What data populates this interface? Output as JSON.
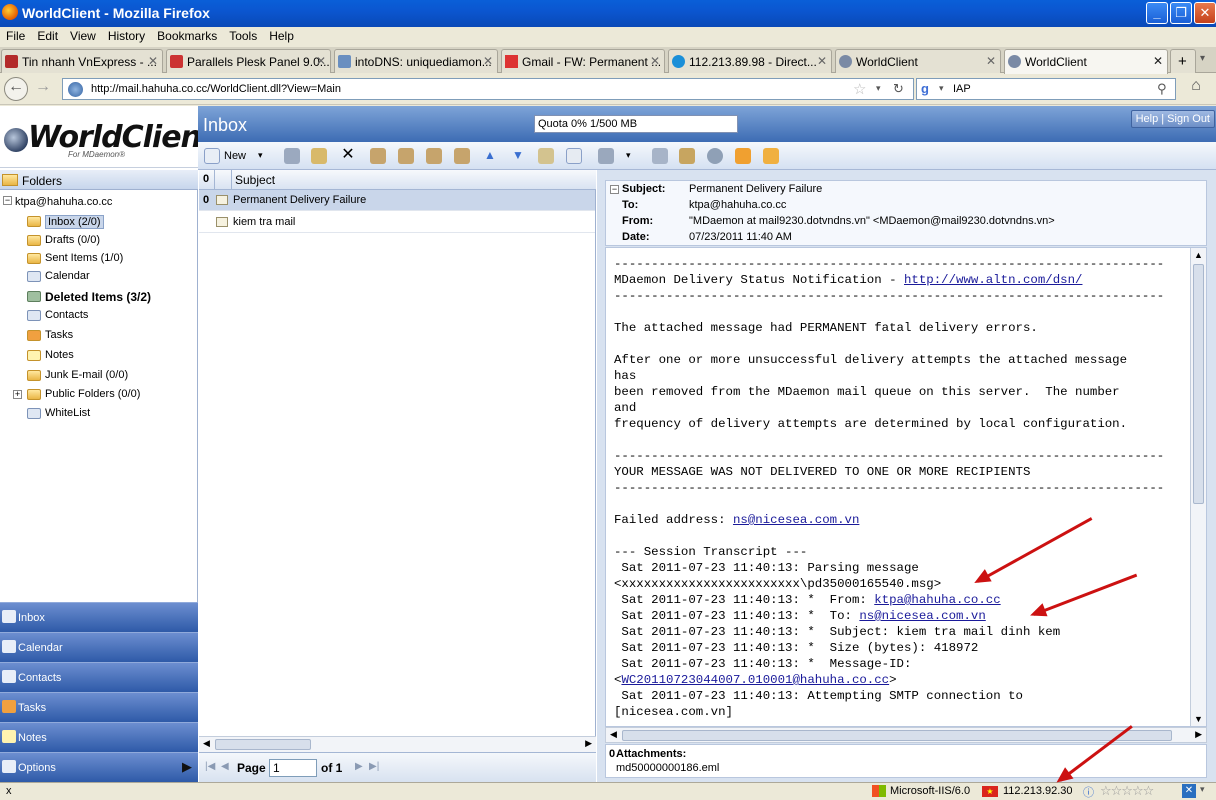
{
  "window": {
    "title": "WorldClient - Mozilla Firefox"
  },
  "menu": [
    "File",
    "Edit",
    "View",
    "History",
    "Bookmarks",
    "Tools",
    "Help"
  ],
  "tabs": [
    {
      "label": "Tin nhanh VnExpress - ..."
    },
    {
      "label": "Parallels Plesk Panel 9.0..."
    },
    {
      "label": "intoDNS: uniquediamon..."
    },
    {
      "label": "Gmail - FW: Permanent ..."
    },
    {
      "label": "112.213.89.98 - Direct..."
    },
    {
      "label": "WorldClient"
    },
    {
      "label": "WorldClient"
    }
  ],
  "nav": {
    "url": "http://mail.hahuha.co.cc/WorldClient.dll?View=Main",
    "search_value": "IAP"
  },
  "app": {
    "logo": "WorldClient",
    "logo_sub": "For MDaemon®",
    "header_title": "Inbox",
    "quota": "Quota 0% 1/500 MB",
    "help_signout": "Help | Sign Out",
    "toolbar_new": "New"
  },
  "folders": {
    "heading": "Folders",
    "account": "ktpa@hahuha.co.cc",
    "items": [
      {
        "label": "Inbox (2/0)"
      },
      {
        "label": "Drafts (0/0)"
      },
      {
        "label": "Sent Items (1/0)"
      },
      {
        "label": "Calendar"
      },
      {
        "label": "Deleted Items (3/2)"
      },
      {
        "label": "Contacts"
      },
      {
        "label": "Tasks"
      },
      {
        "label": "Notes"
      },
      {
        "label": "Junk E-mail (0/0)"
      },
      {
        "label": "Public Folders (0/0)"
      },
      {
        "label": "WhiteList"
      }
    ]
  },
  "bottom_nav": [
    {
      "label": "Inbox"
    },
    {
      "label": "Calendar"
    },
    {
      "label": "Contacts"
    },
    {
      "label": "Tasks"
    },
    {
      "label": "Notes"
    },
    {
      "label": "Options"
    }
  ],
  "list": {
    "column_subject": "Subject",
    "rows": [
      {
        "subject": "Permanent Delivery Failure"
      },
      {
        "subject": "kiem tra mail"
      }
    ],
    "pager": {
      "page_label": "Page",
      "page_value": "1",
      "of_label": "of 1"
    }
  },
  "message": {
    "subject_label": "Subject:",
    "subject": "Permanent Delivery Failure",
    "to_label": "To:",
    "to": "ktpa@hahuha.co.cc",
    "from_label": "From:",
    "from": "\"MDaemon at mail9230.dotvndns.vn\" <MDaemon@mail9230.dotvndns.vn>",
    "date_label": "Date:",
    "date": "07/23/2011 11:40 AM",
    "body": {
      "sep": "--------------------------------------------------------------------------",
      "dsn_title": "MDaemon Delivery Status Notification - ",
      "dsn_link": "http://www.altn.com/dsn/",
      "p1": "The attached message had PERMANENT fatal delivery errors.",
      "p2a": "After one or more unsuccessful delivery attempts the attached message",
      "p2b": "has",
      "p2c": "been removed from the MDaemon mail queue on this server.  The number",
      "p2d": "and",
      "p2e": "frequency of delivery attempts are determined by local configuration.",
      "notdelivered": "YOUR MESSAGE WAS NOT DELIVERED TO ONE OR MORE RECIPIENTS",
      "failed_label": "Failed address: ",
      "failed_addr": "ns@nicesea.com.vn",
      "transcript": "--- Session Transcript ---",
      "t1": " Sat 2011-07-23 11:40:13: Parsing message",
      "t2": "<xxxxxxxxxxxxxxxxxxxxxxxx\\pd35000165540.msg>",
      "t3": " Sat 2011-07-23 11:40:13: *  From: ",
      "t3_link": "ktpa@hahuha.co.cc",
      "t4": " Sat 2011-07-23 11:40:13: *  To: ",
      "t4_link": "ns@nicesea.com.vn",
      "t5": " Sat 2011-07-23 11:40:13: *  Subject: kiem tra mail dinh kem",
      "t6": " Sat 2011-07-23 11:40:13: *  Size (bytes): 418972",
      "t7": " Sat 2011-07-23 11:40:13: *  Message-ID:",
      "t8_open": "<",
      "t8_link": "WC20110723044007.010001@hahuha.co.cc",
      "t8_close": ">",
      "t9": " Sat 2011-07-23 11:40:13: Attempting SMTP connection to",
      "t10": "[nicesea.com.vn]"
    },
    "attachments_label": "Attachments:",
    "attachment_file": "md50000000186.eml"
  },
  "status": {
    "left": "x",
    "server": "Microsoft-IIS/6.0",
    "ip": "112.213.92.30"
  },
  "colors": {
    "annotation_arrow": "#cc1111",
    "link": "#1a1a9a",
    "header_blue": "#3d6cb4"
  }
}
